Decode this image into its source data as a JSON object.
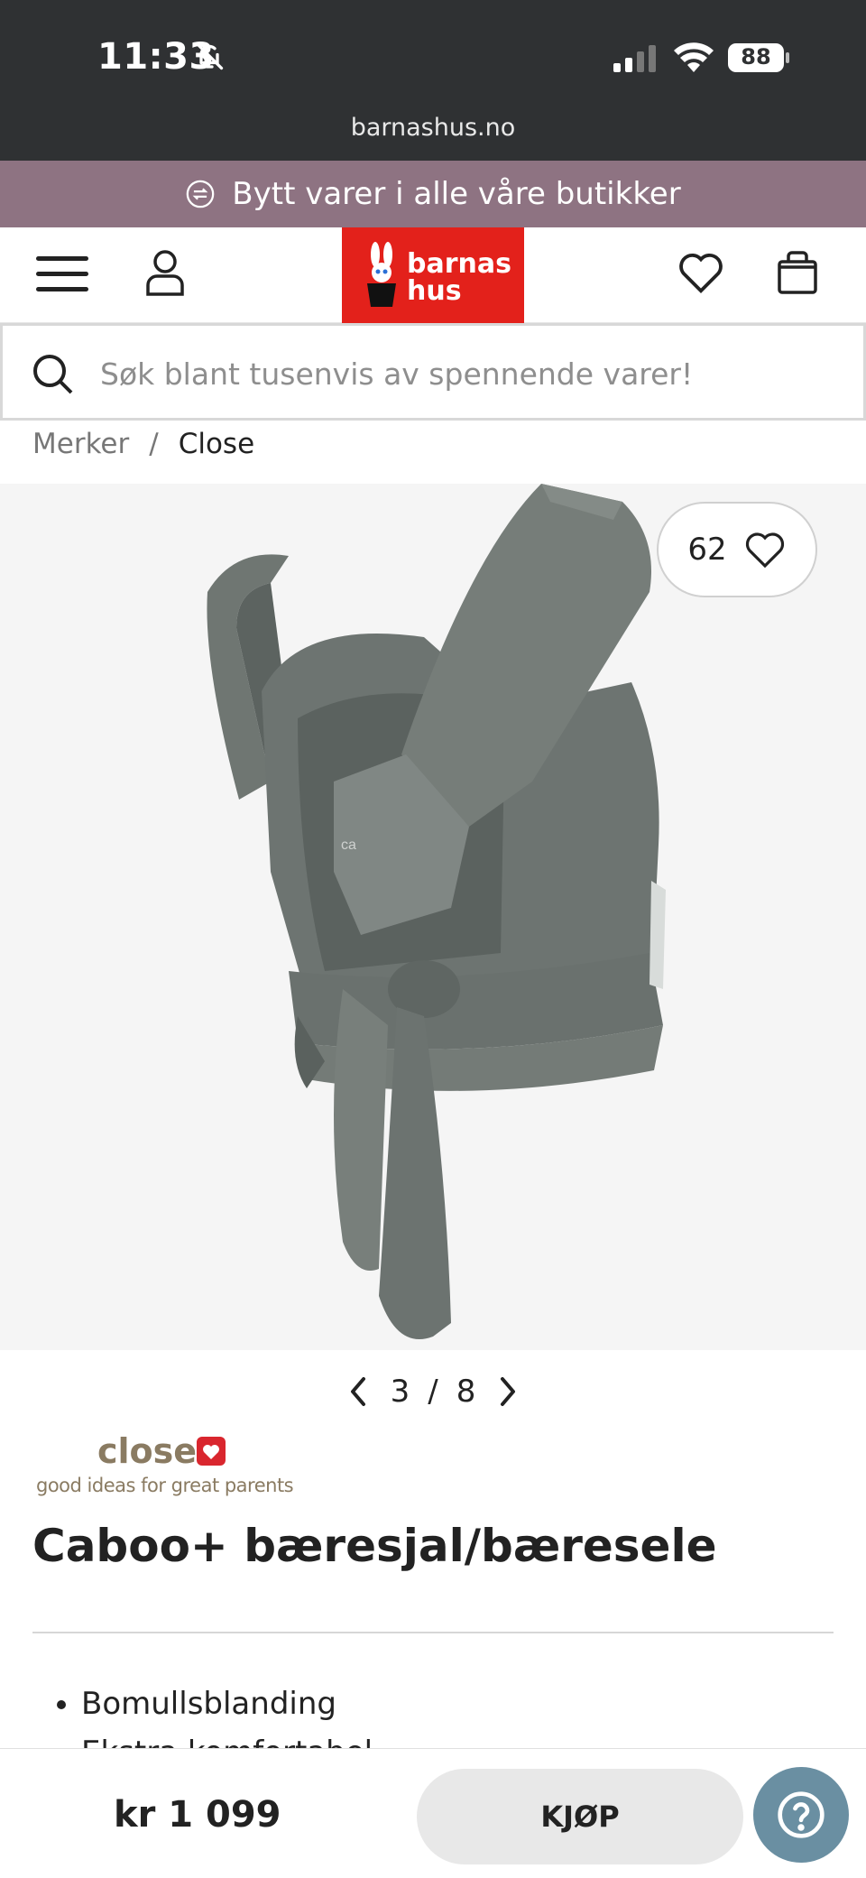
{
  "status_bar": {
    "time": "11:33",
    "battery": "88",
    "url": "barnashus.no"
  },
  "promo": {
    "text": "Bytt varer i alle våre butikker"
  },
  "header": {
    "logo_line1": "barnas",
    "logo_line2": "hus"
  },
  "search": {
    "placeholder": "Søk blant tusenvis av spennende varer!"
  },
  "breadcrumb": {
    "items": [
      "Merker",
      "Close"
    ],
    "separator": "/"
  },
  "gallery": {
    "favorites_count": "62",
    "current": "3",
    "separator": "/",
    "total": "8",
    "image_logo_text": "ca"
  },
  "brand": {
    "name": "close",
    "tagline": "good ideas for great parents"
  },
  "product": {
    "title": "Caboo+ bæresjal/bæresele",
    "features": [
      "Bomullsblanding",
      "Ekstra komfortabel"
    ]
  },
  "purchase": {
    "price": "kr 1 099",
    "buy_label": "KJØP"
  },
  "colors": {
    "promo_bg": "#8e7382",
    "logo_red": "#e3211b",
    "help_bg": "#6a8fa2",
    "status_bg": "#2f3133",
    "brand_brown": "#8a7b62",
    "brand_heart": "#d9262e",
    "product_grey": "#6f7672"
  }
}
